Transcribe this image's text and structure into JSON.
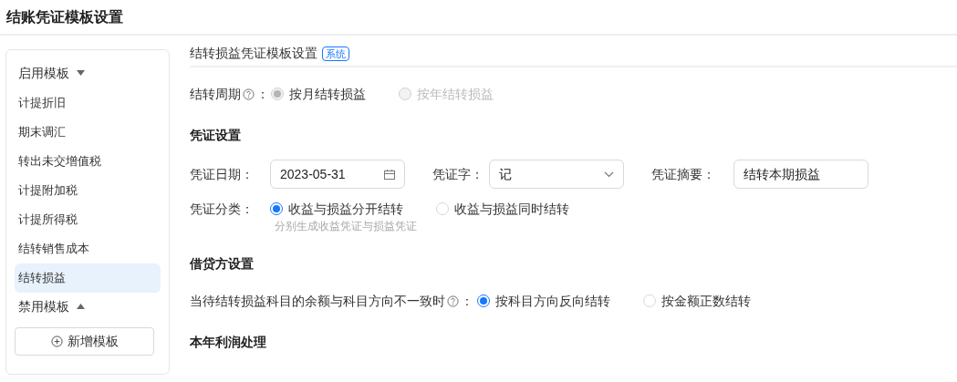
{
  "page_title": "结账凭证模板设置",
  "sidebar": {
    "groups": [
      {
        "label": "启用模板",
        "expanded": true,
        "items": [
          {
            "label": "计提折旧",
            "selected": false
          },
          {
            "label": "期末调汇",
            "selected": false
          },
          {
            "label": "转出未交增值税",
            "selected": false
          },
          {
            "label": "计提附加税",
            "selected": false
          },
          {
            "label": "计提所得税",
            "selected": false
          },
          {
            "label": "结转销售成本",
            "selected": false
          },
          {
            "label": "结转损益",
            "selected": true
          }
        ]
      },
      {
        "label": "禁用模板",
        "expanded": false
      }
    ],
    "add_button": "新增模板"
  },
  "header": {
    "title": "结转损益凭证模板设置",
    "badge": "系统"
  },
  "period": {
    "label": "结转周期",
    "colon": "：",
    "options": [
      {
        "label": "按月结转损益",
        "selected": true,
        "disabled": true
      },
      {
        "label": "按年结转损益",
        "selected": false,
        "disabled": true
      }
    ]
  },
  "voucher_section": "凭证设置",
  "voucher_fields": [
    {
      "kind": "date",
      "label": "凭证日期：",
      "value": "2023-05-31"
    },
    {
      "kind": "select",
      "label": "凭证字：",
      "value": "记"
    },
    {
      "kind": "text",
      "label": "凭证摘要：",
      "value": "结转本期损益"
    }
  ],
  "voucher_type": {
    "label": "凭证分类：",
    "options": [
      {
        "label": "收益与损益分开结转",
        "selected": true,
        "disabled": false
      },
      {
        "label": "收益与损益同时结转",
        "selected": false,
        "disabled": false
      }
    ],
    "hint": "分别生成收益凭证与损益凭证"
  },
  "debit_section": "借贷方设置",
  "direction": {
    "label": "当待结转损益科目的余额与科目方向不一致时",
    "colon": "：",
    "options": [
      {
        "label": "按科目方向反向结转",
        "selected": true,
        "disabled": false
      },
      {
        "label": "按金额正数结转",
        "selected": false,
        "disabled": false
      }
    ]
  },
  "profit_section": "本年利润处理"
}
